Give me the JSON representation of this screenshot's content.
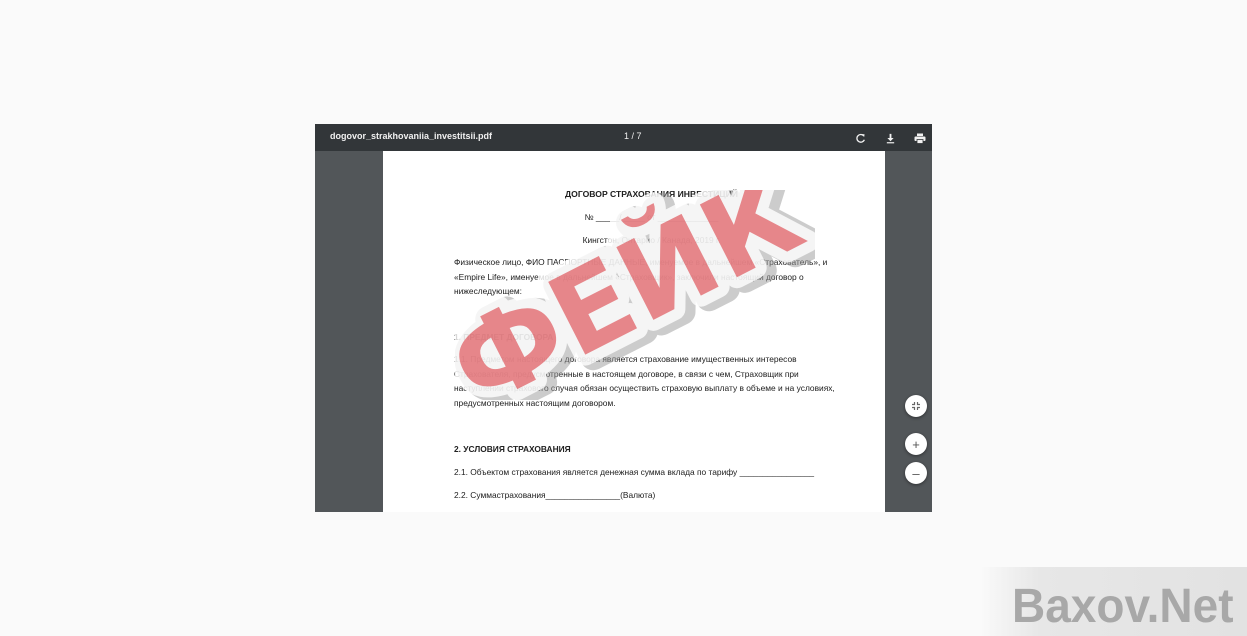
{
  "toolbar": {
    "file_name": "dogovor_strakhovaniia_investitsii.pdf",
    "page_counter": "1 / 7",
    "rotate_icon": "rotate-icon",
    "download_icon": "download-icon",
    "print_icon": "print-icon"
  },
  "document": {
    "title": "ДОГОВОР СТРАХОВАНИЯ ИНВЕСТИЦИЙ",
    "number_line": "№ _____/_____ от _____________",
    "place_line": "Кингстон, Онтарио / Канада, 2019 г.",
    "intro_lines": [
      "Физическое лицо, ФИО ПАСПОРТНЫЕ ДАННЫЕ, именуемое в дальнейшем «Страхователь», и",
      "«Empire Life», именуемое в дальнейшем «Страховщик», заключили настоящий договор о",
      "нижеследующем:"
    ],
    "section1_heading": "1. ПРЕДМЕТ ДОГОВОРА",
    "section1_lines": [
      "1.1. Предметом настоящего договора является страхование имущественных интересов",
      "Страхователя, предусмотренные в настоящем договоре, в связи с чем, Страховщик при",
      "наступлении страхового случая обязан осуществить страховую выплату в объеме и на условиях,",
      "предусмотренных настоящим договором."
    ],
    "section2_heading": "2. УСЛОВИЯ СТРАХОВАНИЯ",
    "clause_2_1": "2.1. Объектом страхования является денежная сумма вклада по тарифу ________________",
    "clause_2_2": "2.2. Суммастрахования________________(Валюта)"
  },
  "stamp": {
    "text": "ФЕЙК",
    "color": "#d9222a"
  },
  "zoom": {
    "fit_icon": "fit-to-page-icon",
    "plus_label": "+",
    "minus_label": "–"
  },
  "site_watermark": "Baxov.Net"
}
